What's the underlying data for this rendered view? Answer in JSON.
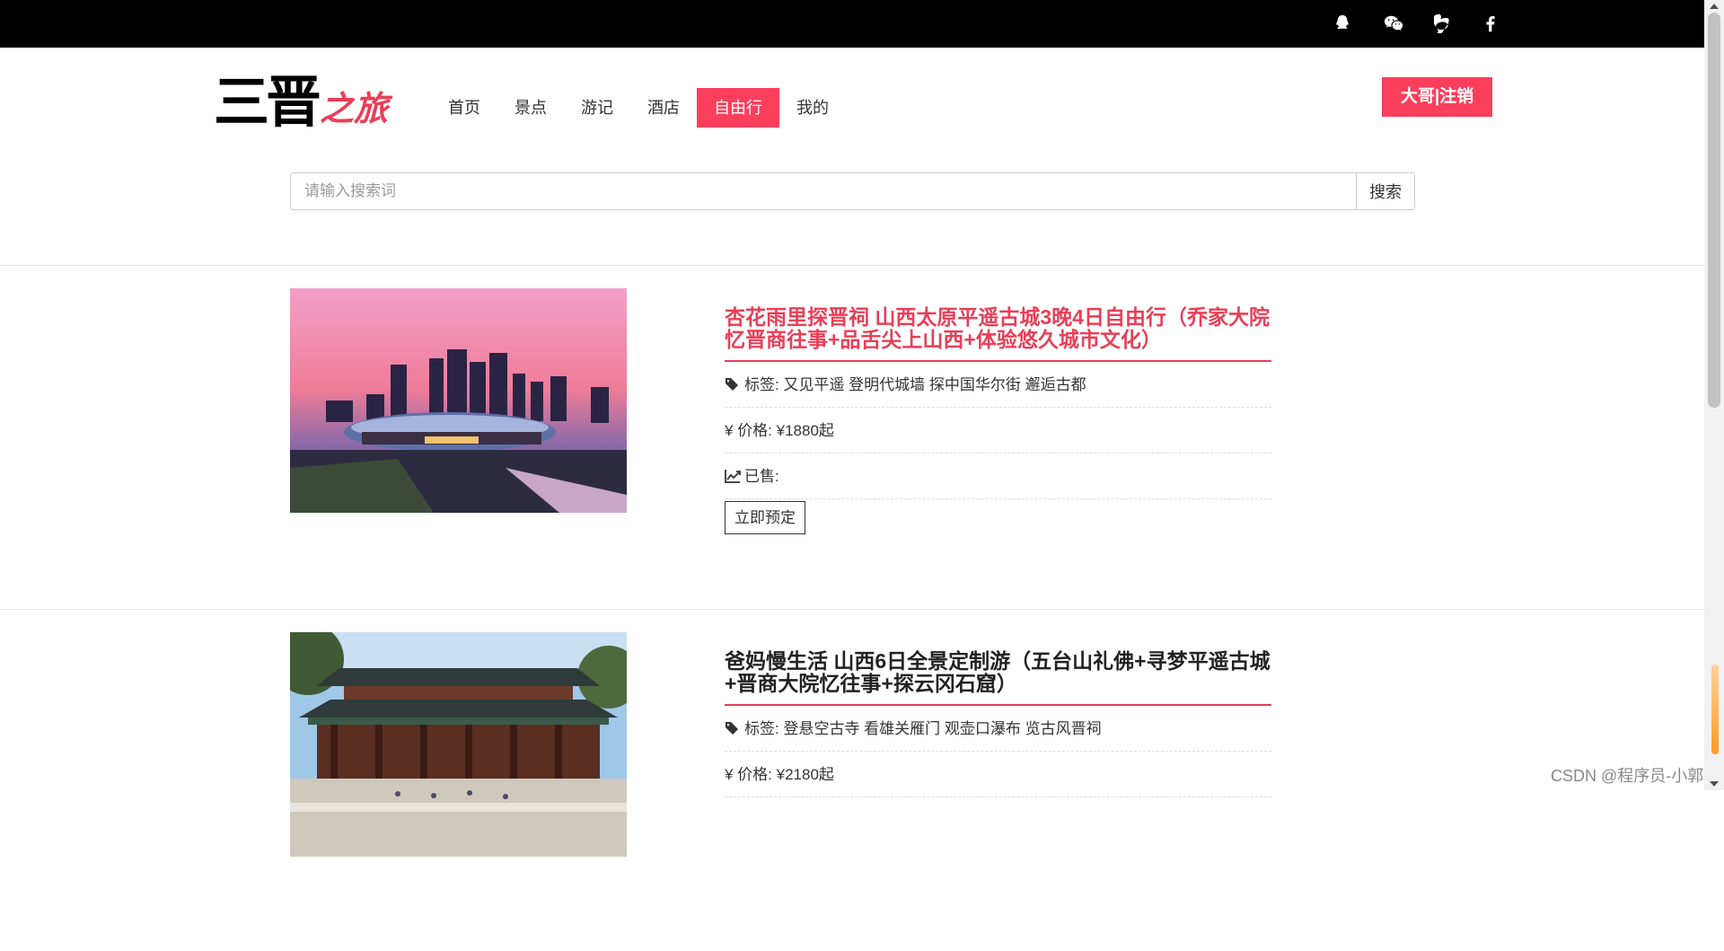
{
  "topbar": {
    "icons": [
      "qq-icon",
      "wechat-icon",
      "weibo-icon",
      "facebook-icon"
    ]
  },
  "header": {
    "logo_main": "三晋",
    "logo_sub": "之旅",
    "nav": [
      "首页",
      "景点",
      "游记",
      "酒店",
      "自由行",
      "我的"
    ],
    "active_nav": "自由行",
    "user_button": "大哥|注销"
  },
  "search": {
    "placeholder": "请输入搜索词",
    "value": "",
    "button": "搜索"
  },
  "products": [
    {
      "title": "杏花雨里探晋祠 山西太原平遥古城3晚4日自由行（乔家大院忆晋商往事+品舌尖上山西+体验悠久城市文化）",
      "tags_label": "标签: 又见平遥 登明代城墙 探中国华尔街 邂逅古都",
      "price_label": "¥ 价格: ¥1880起",
      "sold_label": "已售:",
      "book_button": "立即预定"
    },
    {
      "title": "爸妈慢生活 山西6日全景定制游（五台山礼佛+寻梦平遥古城+晋商大院忆往事+探云冈石窟）",
      "tags_label": "标签: 登悬空古寺 看雄关雁门 观壶口瀑布 览古风晋祠",
      "price_label": "¥ 价格: ¥2180起"
    }
  ],
  "watermark": "CSDN @程序员-小郭",
  "colors": {
    "accent": "#fb3e5b",
    "title_red": "#ea3e57",
    "topbar": "#000000"
  }
}
